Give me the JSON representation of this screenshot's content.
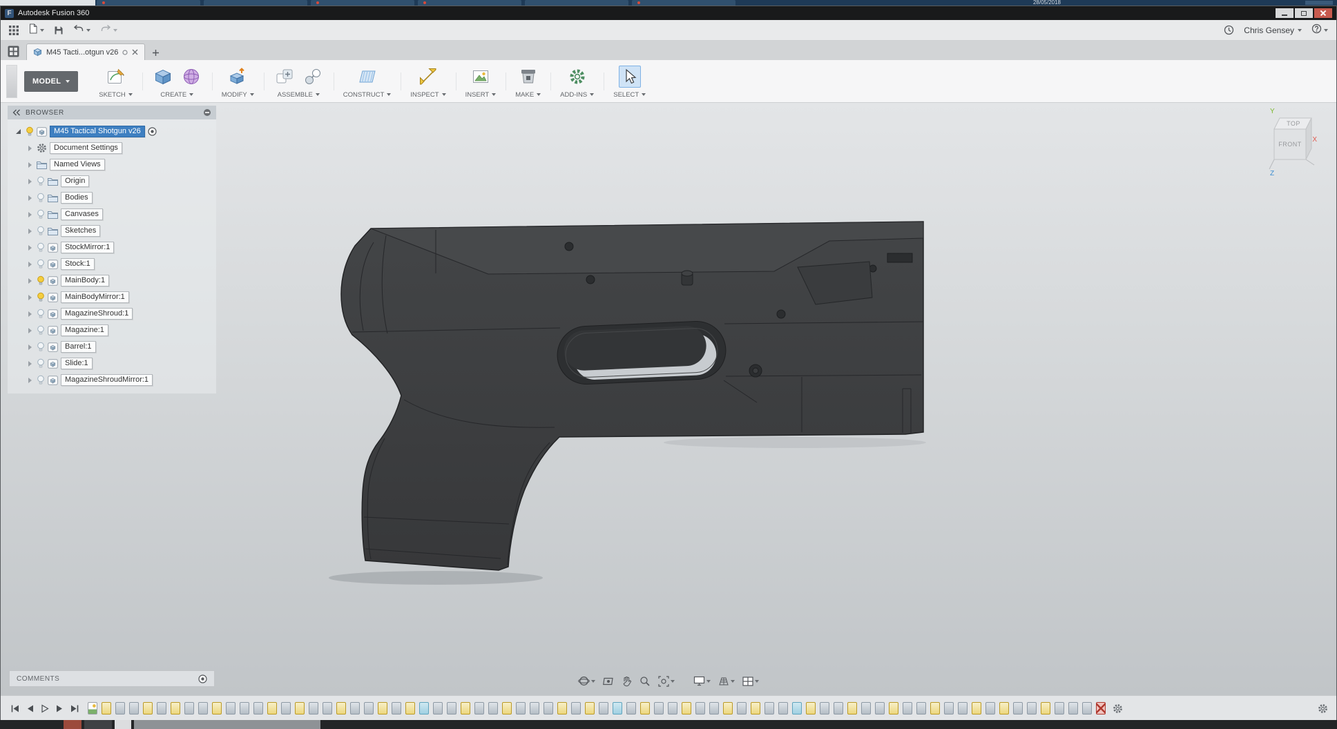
{
  "background": {
    "date_text": "28/05/2018"
  },
  "window": {
    "title": "Autodesk Fusion 360",
    "logo_letter": "F"
  },
  "qat": {
    "user_name": "Chris Gensey"
  },
  "doc_tab": {
    "label": "M45 Tacti...otgun v26"
  },
  "ribbon": {
    "workspace_label": "MODEL",
    "groups": [
      {
        "label": "SKETCH",
        "icons": [
          "create-sketch"
        ]
      },
      {
        "label": "CREATE",
        "icons": [
          "create-box",
          "create-form"
        ]
      },
      {
        "label": "MODIFY",
        "icons": [
          "press-pull"
        ]
      },
      {
        "label": "ASSEMBLE",
        "icons": [
          "new-component",
          "joint"
        ]
      },
      {
        "label": "CONSTRUCT",
        "icons": [
          "construct-plane"
        ]
      },
      {
        "label": "INSPECT",
        "icons": [
          "measure"
        ]
      },
      {
        "label": "INSERT",
        "icons": [
          "insert-canvas"
        ]
      },
      {
        "label": "MAKE",
        "icons": [
          "three-d-print"
        ]
      },
      {
        "label": "ADD-INS",
        "icons": [
          "scripts-addins"
        ]
      },
      {
        "label": "SELECT",
        "icons": [
          "select-cursor"
        ],
        "active": true
      }
    ]
  },
  "browser": {
    "header": "BROWSER",
    "root": {
      "label": "M45 Tactical Shotgun v26"
    },
    "items": [
      {
        "label": "Document Settings",
        "icon": "gear",
        "bulb": "none"
      },
      {
        "label": "Named Views",
        "icon": "folder",
        "bulb": "none"
      },
      {
        "label": "Origin",
        "icon": "folder",
        "bulb": "off"
      },
      {
        "label": "Bodies",
        "icon": "folder",
        "bulb": "off"
      },
      {
        "label": "Canvases",
        "icon": "folder",
        "bulb": "off"
      },
      {
        "label": "Sketches",
        "icon": "folder",
        "bulb": "off"
      },
      {
        "label": "StockMirror:1",
        "icon": "component",
        "bulb": "off"
      },
      {
        "label": "Stock:1",
        "icon": "component",
        "bulb": "off"
      },
      {
        "label": "MainBody:1",
        "icon": "component",
        "bulb": "on"
      },
      {
        "label": "MainBodyMirror:1",
        "icon": "component",
        "bulb": "on"
      },
      {
        "label": "MagazineShroud:1",
        "icon": "component",
        "bulb": "off"
      },
      {
        "label": "Magazine:1",
        "icon": "component",
        "bulb": "off"
      },
      {
        "label": "Barrel:1",
        "icon": "component",
        "bulb": "off"
      },
      {
        "label": "Slide:1",
        "icon": "component",
        "bulb": "off"
      },
      {
        "label": "MagazineShroudMirror:1",
        "icon": "component",
        "bulb": "off"
      }
    ]
  },
  "viewcube": {
    "top_label": "TOP",
    "front_label": "FRONT",
    "axis_x": "X",
    "axis_y": "Y",
    "axis_z": "Z"
  },
  "comments": {
    "label": "COMMENTS"
  },
  "nav_bar": {
    "icons": [
      "orbit",
      "look-at",
      "pan",
      "zoom",
      "fit",
      "display-settings",
      "grid-display",
      "viewports"
    ]
  },
  "timeline": {
    "playback": [
      "go-to-start",
      "step-back",
      "play",
      "step-forward",
      "go-to-end"
    ],
    "features": [
      "canvas",
      "sketch",
      "extrude",
      "extrude",
      "sketch",
      "extrude",
      "sketch",
      "extrude",
      "extrude",
      "sketch",
      "extrude",
      "extrude",
      "extrude",
      "sketch",
      "extrude",
      "sketch",
      "extrude",
      "extrude",
      "sketch",
      "extrude",
      "extrude",
      "sketch",
      "extrude",
      "sketch",
      "mirror",
      "extrude",
      "extrude",
      "sketch",
      "extrude",
      "extrude",
      "sketch",
      "extrude",
      "extrude",
      "extrude",
      "sketch",
      "extrude",
      "sketch",
      "extrude",
      "mirror",
      "extrude",
      "sketch",
      "extrude",
      "extrude",
      "sketch",
      "extrude",
      "extrude",
      "sketch",
      "extrude",
      "sketch",
      "extrude",
      "extrude",
      "mirror",
      "sketch",
      "extrude",
      "extrude",
      "sketch",
      "extrude",
      "extrude",
      "sketch",
      "extrude",
      "extrude",
      "sketch",
      "extrude",
      "extrude",
      "sketch",
      "extrude",
      "sketch",
      "extrude",
      "extrude",
      "sketch",
      "extrude",
      "extrude",
      "extrude",
      "error"
    ]
  },
  "colors": {
    "accent_blue": "#3e7fc1",
    "bulb_on": "#f5ce3e",
    "model_gray": "#3b3d3f"
  }
}
